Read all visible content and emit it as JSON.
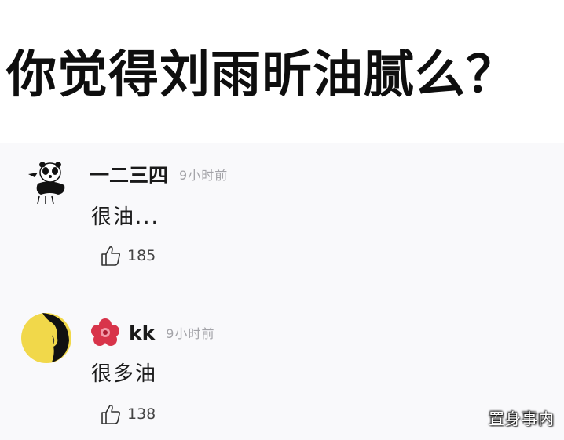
{
  "question": "你觉得刘雨昕油腻么？",
  "comments": [
    {
      "username": "一二三四",
      "time": "9小时前",
      "text": "很油...",
      "likes": "185",
      "avatar_icon": "panda-meme-icon"
    },
    {
      "username": "kk",
      "time": "9小时前",
      "text": "很多油",
      "likes": "138",
      "avatar_icon": "silhouette-portrait-icon",
      "badge_icon": "red-flower-badge-icon"
    }
  ],
  "watermark": "置身事内",
  "colors": {
    "card_bg": "#f9f9fb",
    "avatar2_bg": "#f1d84a",
    "badge_red": "#d8344a"
  }
}
